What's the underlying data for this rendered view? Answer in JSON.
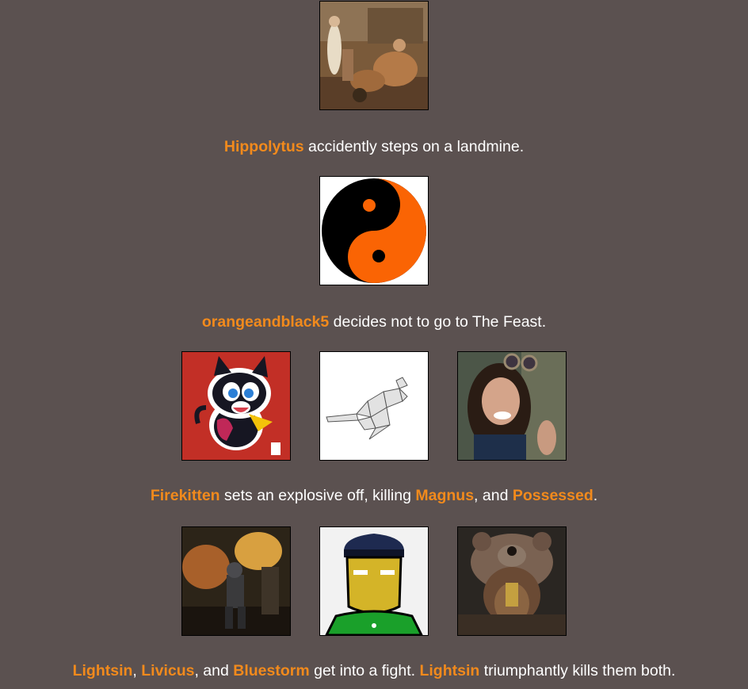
{
  "events": [
    {
      "avatars": [
        {
          "name": "Hippolytus",
          "icon": "classical-painting-avatar"
        }
      ],
      "caption": {
        "n1": "Hippolytus",
        "t1": " accidently steps on a landmine."
      }
    },
    {
      "avatars": [
        {
          "name": "orangeandblack5",
          "icon": "yin-yang-avatar"
        }
      ],
      "caption": {
        "n1": "orangeandblack5",
        "t1": " decides not to go to The Feast."
      }
    },
    {
      "avatars": [
        {
          "name": "Firekitten",
          "icon": "cartoon-cat-avatar"
        },
        {
          "name": "Magnus",
          "icon": "polygon-kangaroo-avatar"
        },
        {
          "name": "Possessed",
          "icon": "steampunk-woman-avatar"
        }
      ],
      "caption": {
        "n1": "Firekitten",
        "t1": " sets an explosive off, killing ",
        "n2": "Magnus",
        "t2": ", and ",
        "n3": "Possessed",
        "t3": "."
      }
    },
    {
      "avatars": [
        {
          "name": "Lightsin",
          "icon": "armored-soldier-avatar"
        },
        {
          "name": "Livicus",
          "icon": "cartoon-police-avatar"
        },
        {
          "name": "Bluestorm",
          "icon": "bear-warrior-avatar"
        }
      ],
      "caption": {
        "n1": "Lightsin",
        "t1": ", ",
        "n2": "Livicus",
        "t2": ", and ",
        "n3": "Bluestorm",
        "t3": " get into a fight. ",
        "n4": "Lightsin",
        "t4": " triumphantly kills them both."
      }
    }
  ],
  "colors": {
    "background": "#5b5150",
    "name_highlight": "#f28a1c",
    "text": "#ffffff"
  }
}
